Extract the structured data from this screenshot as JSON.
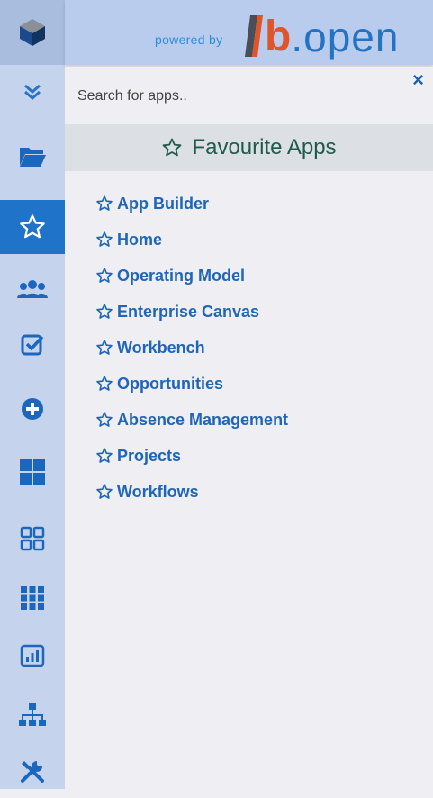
{
  "header": {
    "powered_by": "powered by",
    "brand_b": "b",
    "brand_open": ".open"
  },
  "search": {
    "placeholder": "Search for apps.."
  },
  "close_label": "×",
  "favourites": {
    "title": "Favourite Apps",
    "apps": [
      "App Builder",
      "Home",
      "Operating Model",
      "Enterprise Canvas",
      "Workbench",
      "Opportunities",
      "Absence Management",
      "Projects",
      "Workflows"
    ]
  },
  "rail_icons": [
    "cube-logo-icon",
    "double-chevron-down-icon",
    "folder-open-icon",
    "star-icon",
    "users-icon",
    "check-square-icon",
    "plus-circle-icon",
    "th-large-icon",
    "grid-outline-icon",
    "th-icon",
    "bar-chart-icon",
    "sitemap-icon",
    "tools-icon"
  ],
  "colors": {
    "accent": "#1f73c9",
    "link": "#1f65ba",
    "rail": "#c5d4ec",
    "brand_orange": "#e0542a"
  }
}
